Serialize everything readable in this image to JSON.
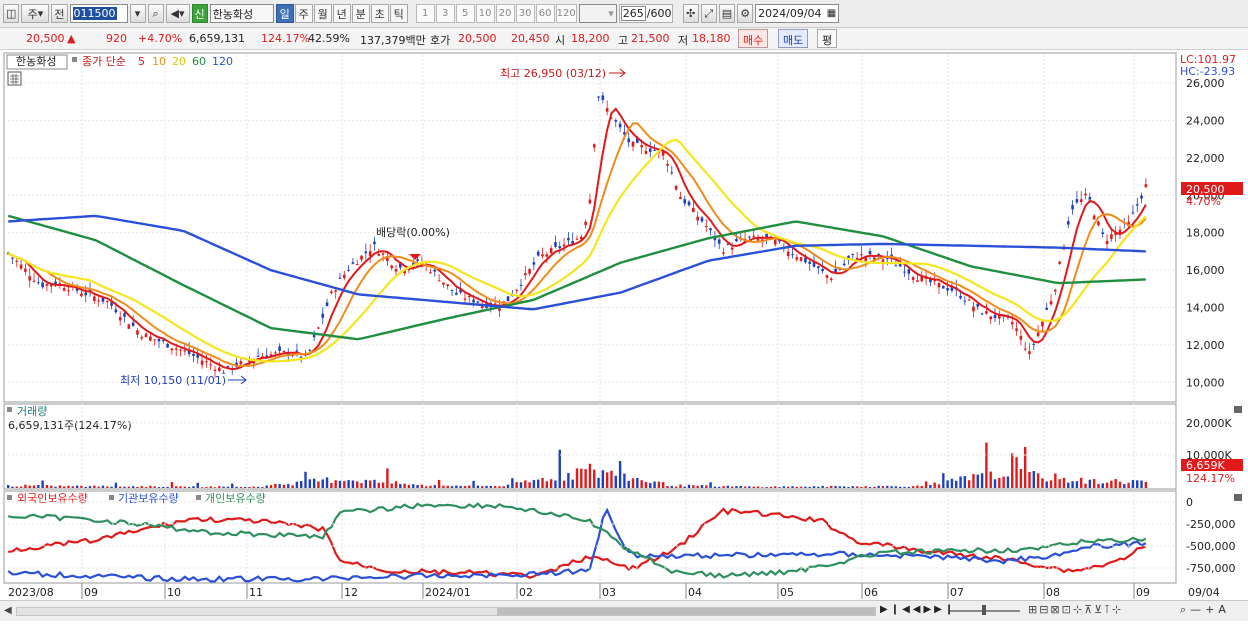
{
  "toolbar": {
    "period_select": "주",
    "prev_label": "전",
    "code": "011500",
    "stock_badge": "신",
    "stock_name": "한농화성",
    "tabs": [
      "일",
      "주",
      "월",
      "년",
      "분",
      "초",
      "틱"
    ],
    "active_tab": "일",
    "intervals": [
      "1",
      "3",
      "5",
      "10",
      "20",
      "30",
      "60",
      "120"
    ],
    "count_value": "265",
    "count_total": "/600",
    "date": "2024/09/04"
  },
  "quote": {
    "price": "20,500",
    "arrow": "▲",
    "change": "920",
    "change_pct": "+4.70%",
    "volume": "6,659,131",
    "vol_ratio": "124.17%",
    "turnover": "42.59%",
    "amount": "137,379백만",
    "bid_label": "호가",
    "ask_price": "20,500",
    "bid_price": "20,450",
    "open_label": "시",
    "open": "18,200",
    "high_label": "고",
    "high": "21,500",
    "low_label": "저",
    "low": "18,180",
    "buy_button": "매수",
    "sell_button": "매도",
    "eval_button": "평"
  },
  "price_panel": {
    "legend_name": "한농화성",
    "legend_series": "종가 단순",
    "ma_periods": [
      "5",
      "10",
      "20",
      "60",
      "120"
    ],
    "ma_colors": [
      "#e01a1a",
      "#f08c1a",
      "#f5e61c",
      "#1f8f3f",
      "#2b50d8"
    ],
    "lc_label": "LC:101.97",
    "hc_label": "HC:-23.93",
    "high_annotation": "최고 26,950 (03/12)",
    "low_annotation": "최저 10,150 (11/01)",
    "dividend_annotation": "배당락(0.00%)",
    "price_tag": "20,500",
    "pct_tag": "4.70%"
  },
  "volume_panel": {
    "title": "거래량",
    "value_line": "6,659,131주(124.17%)",
    "tag_value": "6,659K",
    "tag_pct": "124.17%"
  },
  "holding_panel": {
    "legend": [
      "외국인보유수량",
      "기관보유수량",
      "개인보유수량"
    ],
    "colors": [
      "#e01a1a",
      "#2b50d8",
      "#2f8f5f"
    ]
  },
  "x_labels": [
    "2023/08",
    "09",
    "10",
    "11",
    "12",
    "2024/01",
    "02",
    "03",
    "04",
    "05",
    "06",
    "07",
    "08",
    "09",
    "09/04"
  ],
  "chart_data": {
    "type": "line",
    "price_axis": {
      "ticks": [
        "26,000",
        "24,000",
        "22,000",
        "20,000",
        "18,000",
        "16,000",
        "14,000",
        "12,000",
        "10,000"
      ],
      "ylim": [
        9000,
        27500
      ]
    },
    "volume_axis": {
      "ticks": [
        "20,000K",
        "10,000K"
      ]
    },
    "holding_axis": {
      "ticks": [
        "0",
        "-250,000",
        "-500,000",
        "-750,000"
      ]
    },
    "months": [
      "2023/08",
      "09",
      "10",
      "11",
      "12",
      "2024/01",
      "02",
      "03",
      "04",
      "05",
      "06",
      "07",
      "08",
      "09"
    ],
    "close": [
      16700,
      15200,
      12100,
      10600,
      16600,
      16100,
      14400,
      25000,
      18500,
      17200,
      15900,
      15600,
      11800,
      20500
    ],
    "ma120": [
      18600,
      18900,
      18100,
      16000,
      14700,
      14300,
      13900,
      14800,
      16500,
      17300,
      17400,
      17300,
      17200,
      17000
    ],
    "ma60": [
      18900,
      17600,
      15200,
      12900,
      12300,
      13400,
      14400,
      16400,
      17700,
      18600,
      17800,
      16200,
      15300,
      15500
    ],
    "volume_k": [
      2400,
      1800,
      1500,
      1200,
      9300,
      2500,
      2200,
      17800,
      2600,
      1300,
      1600,
      1900,
      15600,
      6659
    ]
  }
}
